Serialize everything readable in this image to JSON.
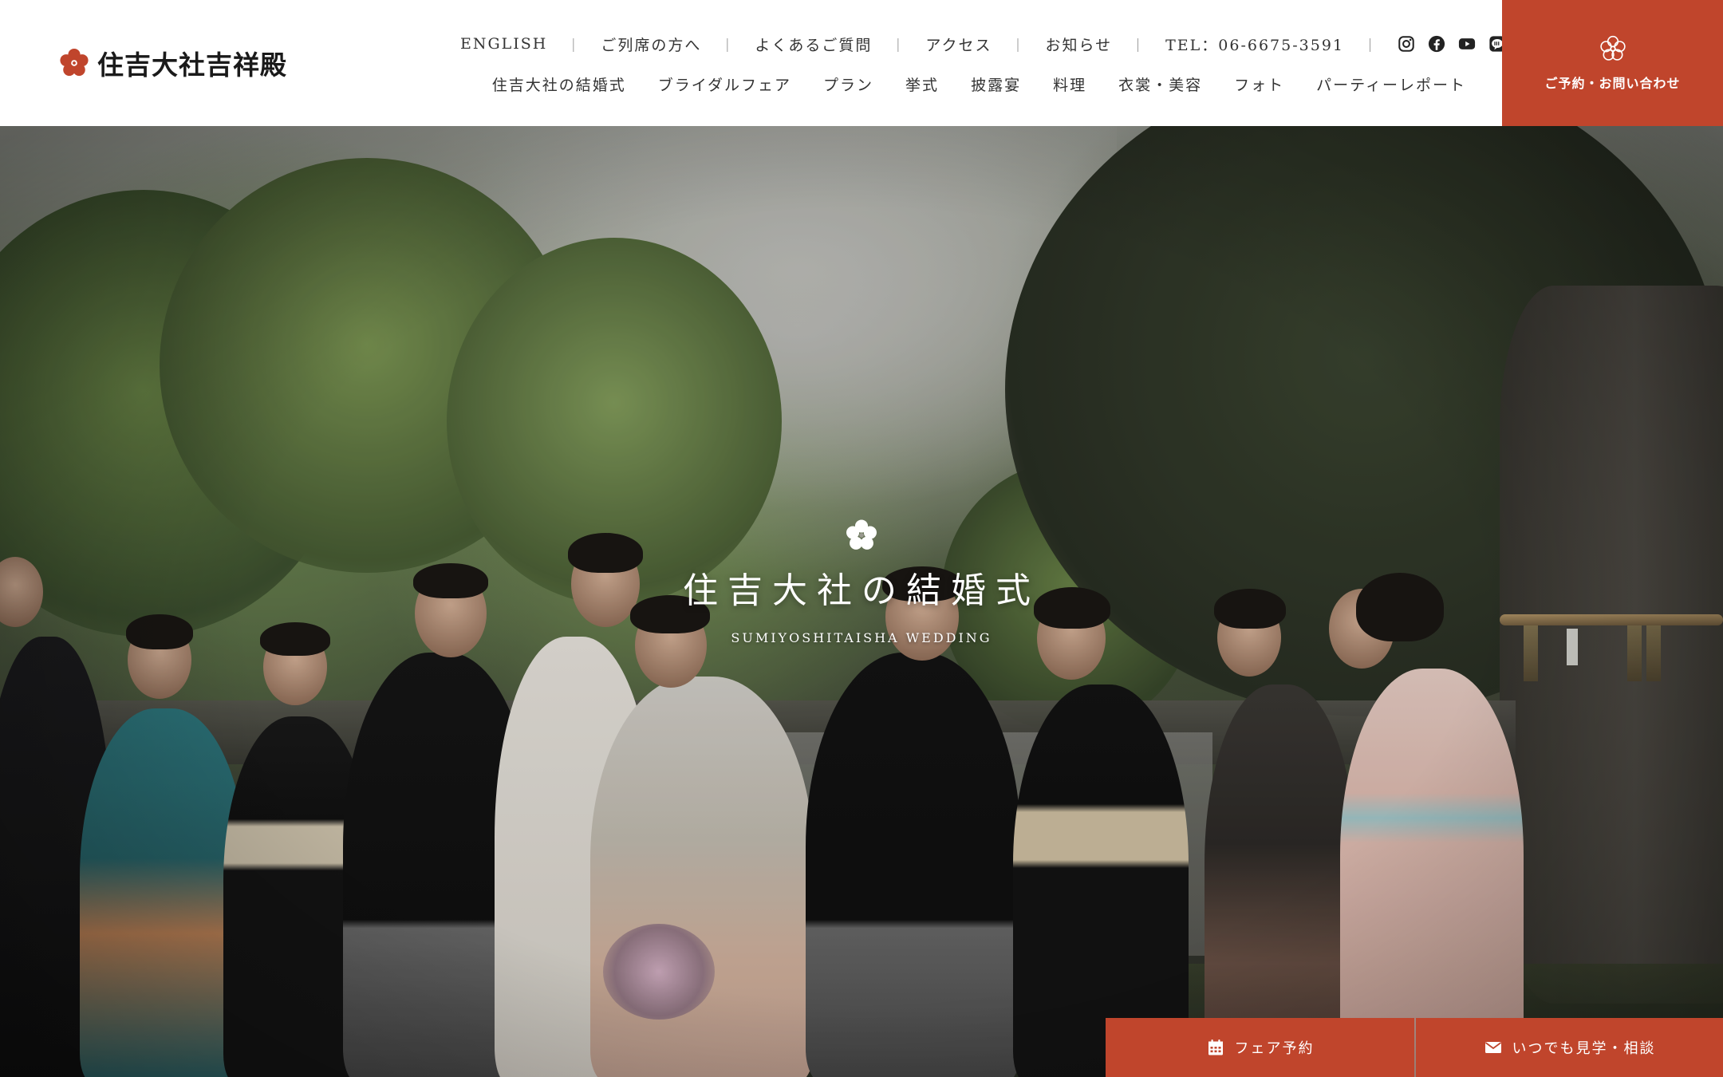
{
  "brand": {
    "name": "住吉大社吉祥殿",
    "accent_color": "#c0452c"
  },
  "top_nav": {
    "items": [
      {
        "label": "ENGLISH"
      },
      {
        "label": "ご列席の方へ"
      },
      {
        "label": "よくあるご質問"
      },
      {
        "label": "アクセス"
      },
      {
        "label": "お知らせ"
      },
      {
        "label": "TEL：06-6675-3591"
      }
    ],
    "separator": "｜",
    "social_icons": [
      "instagram-icon",
      "facebook-icon",
      "youtube-icon",
      "line-icon"
    ]
  },
  "main_nav": {
    "items": [
      {
        "label": "住吉大社の結婚式"
      },
      {
        "label": "ブライダルフェア"
      },
      {
        "label": "プラン"
      },
      {
        "label": "挙式"
      },
      {
        "label": "披露宴"
      },
      {
        "label": "料理"
      },
      {
        "label": "衣裳・美容"
      },
      {
        "label": "フォト"
      },
      {
        "label": "パーティーレポート"
      }
    ]
  },
  "reserve_button": {
    "label": "ご予約・お問い合わせ",
    "icon": "plum-blossom-icon"
  },
  "hero": {
    "title": "住吉大社の結婚式",
    "subtitle": "SUMIYOSHITAISHA WEDDING",
    "icon": "plum-blossom-icon"
  },
  "cta": {
    "fair": {
      "label": "フェア予約",
      "icon": "calendar-icon"
    },
    "visit": {
      "label": "いつでも見学・相談",
      "icon": "mail-icon"
    }
  }
}
